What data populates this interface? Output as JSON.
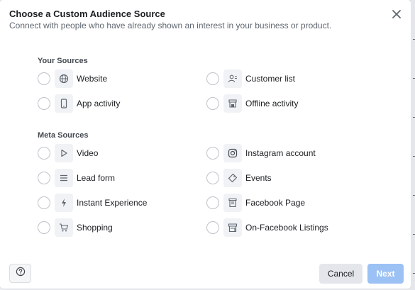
{
  "dialog": {
    "title": "Choose a Custom Audience Source",
    "subtitle": "Connect with people who have already shown an interest in your business or product."
  },
  "your_sources": {
    "heading": "Your Sources",
    "options": [
      {
        "label": "Website",
        "icon": "globe-icon"
      },
      {
        "label": "App activity",
        "icon": "mobile-phone-icon"
      },
      {
        "label": "Customer list",
        "icon": "customer-list-icon"
      },
      {
        "label": "Offline activity",
        "icon": "store-icon"
      }
    ]
  },
  "meta_sources": {
    "heading": "Meta Sources",
    "options": [
      {
        "label": "Video",
        "icon": "play-icon"
      },
      {
        "label": "Lead form",
        "icon": "lines-icon"
      },
      {
        "label": "Instant Experience",
        "icon": "lightning-icon"
      },
      {
        "label": "Shopping",
        "icon": "cart-icon"
      },
      {
        "label": "Instagram account",
        "icon": "instagram-icon"
      },
      {
        "label": "Events",
        "icon": "ticket-icon"
      },
      {
        "label": "Facebook Page",
        "icon": "page-icon"
      },
      {
        "label": "On-Facebook Listings",
        "icon": "storefront-icon"
      }
    ]
  },
  "footer": {
    "cancel_label": "Cancel",
    "next_label": "Next"
  },
  "colors": {
    "primary_disabled": "#9cc2f5",
    "radio_border": "#bec3c9",
    "icon_bg": "#f0f2f5"
  }
}
